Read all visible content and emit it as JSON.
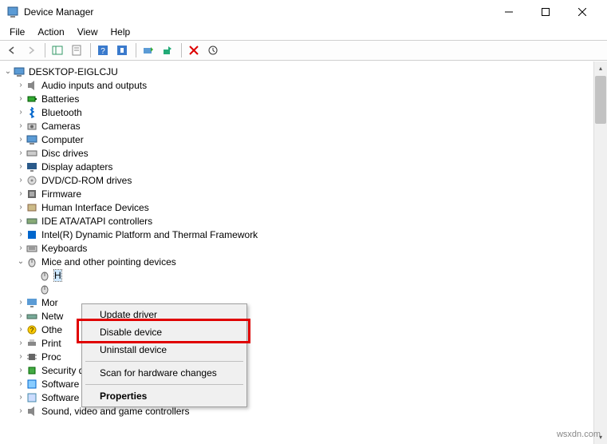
{
  "title": "Device Manager",
  "menu": [
    "File",
    "Action",
    "View",
    "Help"
  ],
  "root": "DESKTOP-EIGLCJU",
  "categories": [
    {
      "name": "Audio inputs and outputs",
      "icon": "audio"
    },
    {
      "name": "Batteries",
      "icon": "battery"
    },
    {
      "name": "Bluetooth",
      "icon": "bluetooth"
    },
    {
      "name": "Cameras",
      "icon": "camera"
    },
    {
      "name": "Computer",
      "icon": "computer"
    },
    {
      "name": "Disc drives",
      "icon": "disc"
    },
    {
      "name": "Display adapters",
      "icon": "display"
    },
    {
      "name": "DVD/CD-ROM drives",
      "icon": "dvd"
    },
    {
      "name": "Firmware",
      "icon": "firmware"
    },
    {
      "name": "Human Interface Devices",
      "icon": "hid"
    },
    {
      "name": "IDE ATA/ATAPI controllers",
      "icon": "ide"
    },
    {
      "name": "Intel(R) Dynamic Platform and Thermal Framework",
      "icon": "intel"
    },
    {
      "name": "Keyboards",
      "icon": "keyboard"
    }
  ],
  "expanded_category": "Mice and other pointing devices",
  "mice_children": [
    {
      "label": "H",
      "selected": true,
      "icon": "mouse"
    },
    {
      "label": "",
      "selected": false,
      "icon": "mouse"
    }
  ],
  "after_categories": [
    {
      "name": "Mor",
      "icon": "monitor"
    },
    {
      "name": "Netw",
      "icon": "network"
    },
    {
      "name": "Othe",
      "icon": "other"
    },
    {
      "name": "Print",
      "icon": "print"
    },
    {
      "name": "Proc",
      "icon": "cpu"
    },
    {
      "name": "Security devices",
      "icon": "security"
    },
    {
      "name": "Software components",
      "icon": "swcomp"
    },
    {
      "name": "Software devices",
      "icon": "swdev"
    },
    {
      "name": "Sound, video and game controllers",
      "icon": "sound"
    }
  ],
  "context_menu": {
    "items": [
      {
        "label": "Update driver",
        "type": "item"
      },
      {
        "label": "Disable device",
        "type": "item",
        "highlight": true
      },
      {
        "label": "Uninstall device",
        "type": "item"
      },
      {
        "type": "sep"
      },
      {
        "label": "Scan for hardware changes",
        "type": "item"
      },
      {
        "type": "sep"
      },
      {
        "label": "Properties",
        "type": "item",
        "bold": true
      }
    ]
  },
  "watermark": "wsxdn.com"
}
